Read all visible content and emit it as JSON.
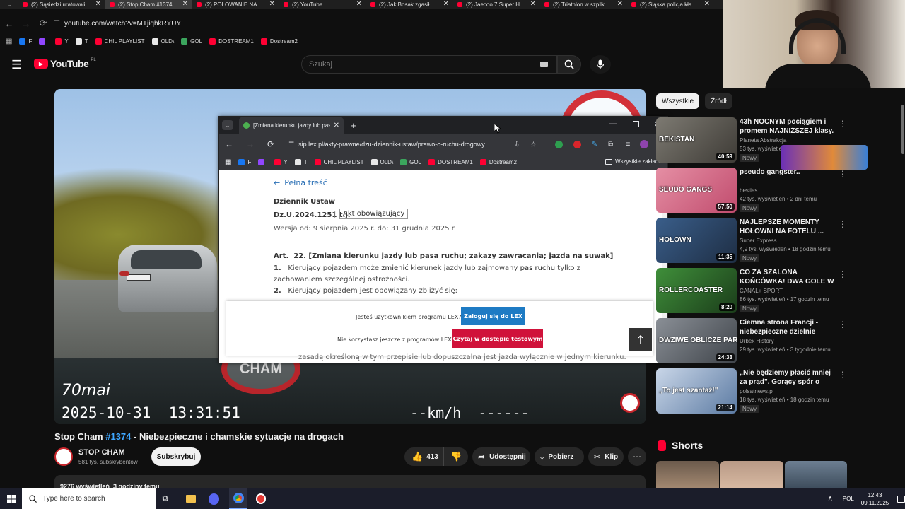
{
  "browser": {
    "tabs": [
      {
        "label": "(2) Sąsiedzi uratowali",
        "active": false
      },
      {
        "label": "(2) Stop Cham #1374",
        "active": true
      },
      {
        "label": "(2) POLOWANIE NA",
        "active": false
      },
      {
        "label": "(2) YouTube",
        "active": false
      },
      {
        "label": "(2) Jak Bosak zgasił",
        "active": false
      },
      {
        "label": "(2) Jaecoo 7 Super H",
        "active": false
      },
      {
        "label": "(2) Triathlon w szpilk",
        "active": false
      },
      {
        "label": "(2) Śląska policja kła",
        "active": false
      }
    ],
    "url": "youtube.com/watch?v=MTjiqhkRYUY",
    "bookmarks": [
      {
        "label": "F",
        "color": "#1877f2"
      },
      {
        "label": "",
        "color": "#9146ff"
      },
      {
        "label": "Y",
        "color": "#ff0033"
      },
      {
        "label": "T",
        "color": "#e8e8e8"
      },
      {
        "label": "CHIL PLAYLIST",
        "color": "#ff0033"
      },
      {
        "label": "OLD\\",
        "color": "#e8e8e8"
      },
      {
        "label": "GOL",
        "color": "#3ba55d"
      },
      {
        "label": "DOSTREAM1",
        "color": "#ff0033"
      },
      {
        "label": "Dostream2",
        "color": "#ff0033"
      }
    ]
  },
  "youtube": {
    "logo": "YouTube",
    "logo_sup": "PL",
    "search_placeholder": "Szukaj"
  },
  "video": {
    "cam_brand": "70mai",
    "timestamp": "2025-10-31  13:31:51",
    "speed": "--km/h  ------",
    "title_prefix": "Stop Cham ",
    "title_tag": "#1374",
    "title_suffix": " - Niebezpieczne i chamskie sytuacje na drogach",
    "channel": "STOP CHAM",
    "subs": "581 tys. subskrybentów",
    "subscribe": "Subskrybuj",
    "likes": "413",
    "share": "Udostępnij",
    "download": "Pobierz",
    "clip": "Klip",
    "views_line": "9276 wyświetleń  3 godziny temu"
  },
  "popup": {
    "tab_title": "[Zmiana kierunku jazdy lub pas",
    "url": "sip.lex.pl/akty-prawne/dzu-dziennik-ustaw/prawo-o-ruchu-drogowy...",
    "bookmarks": [
      "F",
      "",
      "Y",
      "T",
      "CHIL PLAYLIST",
      "OLD\\",
      "GOL",
      "DOSTREAM1",
      "Dostream2"
    ],
    "all_bookmarks": "Wszystkie zakładki",
    "back_link": "Pełna treść",
    "journal": "Dziennik Ustaw",
    "act_ref": "Dz.U.2024.1251 t.j.",
    "act_status": "Akt obowiązujący",
    "version": "Wersja od: 9 sierpnia 2025 r. do: 31 grudnia 2025 r.",
    "art_no": "Art.  22.",
    "art_title": "[Zmiana kierunku jazdy lub pasa ruchu; zakazy zawracania; jazda na suwak]",
    "p1_num": "1.",
    "p1_a": "Kierujący pojazdem może ",
    "p1_b": "zmienić",
    "p1_c": " kierunek jazdy lub zajmowany ",
    "p1_d": "pas ruchu",
    "p1_e": " tylko z",
    "p1_line2": "zachowaniem szczególnej ostrożności.",
    "p2_num": "2.",
    "p2_text": "Kierujący pojazdem jest obowiązany zbliżyć się:",
    "hidden_line": "zasadą określoną w tym przepisie lub dopuszczalna jest jazda wyłącznie w jednym kierunku.",
    "q1": "Jesteś użytkownikiem programu LEX?",
    "btn_login": "Zaloguj się do LEX",
    "q2": "Nie korzystasz jeszcze z programów LEX?",
    "btn_trial": "Czytaj w dostępie testowym"
  },
  "sidebar": {
    "chips": [
      "Wszystkie",
      "Źródł"
    ],
    "recs": [
      {
        "title": "43h NOCNYM pociągiem i promem NAJNIŻSZEJ klasy.",
        "channel": "Planeta Abstrakcja",
        "meta": "53 tys. wyświetleń",
        "badge": "Nowy",
        "duration": "40:59",
        "thumb_text": "BEKISTAN",
        "c1": "#7d7a72",
        "c2": "#3e3b36"
      },
      {
        "title": "pseudo gangster..",
        "channel": "besties",
        "meta": "42 tys. wyświetleń • 2 dni temu",
        "badge": "Nowy",
        "duration": "57:50",
        "thumb_text": "SEUDO GANGS",
        "c1": "#e58fa4",
        "c2": "#c14c6e"
      },
      {
        "title": "NAJLEPSZE MOMENTY HOŁOWNI NA FOTELU ...",
        "channel": "Super Express",
        "meta": "4,9 tys. wyświetleń • 18 godzin temu",
        "badge": "Nowy",
        "duration": "11:35",
        "thumb_text": "HOŁOWN",
        "c1": "#3a5e8a",
        "c2": "#1e2e44"
      },
      {
        "title": "CO ZA SZALONA KOŃCÓWKA! DWA GOLE W DOLICZONYM ...",
        "channel": "CANAL+ SPORT",
        "meta": "86 tys. wyświetleń • 17 godzin temu",
        "badge": "Nowy",
        "duration": "8:20",
        "thumb_text": "ROLLERCOASTER",
        "c1": "#3f8f3a",
        "c2": "#1b3d1a"
      },
      {
        "title": "Ciemna strona Francji - niebezpieczne dzielnie Paryża",
        "channel": "Urbex History",
        "meta": "29 tys. wyświetleń • 3 tygodnie temu",
        "badge": "",
        "duration": "24:33",
        "thumb_text": "DWZIWE OBLICZE PARYŻA",
        "c1": "#8a8f96",
        "c2": "#3f444a"
      },
      {
        "title": "„Nie będziemy płacić mniej za prąd\". Gorący spór o przyszłoś...",
        "channel": "polsatnews.pl",
        "meta": "18 tys. wyświetleń • 18 godzin temu",
        "badge": "Nowy",
        "duration": "21:14",
        "thumb_text": "„To jest szantaż!\"",
        "c1": "#c9d6e8",
        "c2": "#5c7ba3"
      }
    ],
    "shorts_label": "Shorts"
  },
  "taskbar": {
    "search_placeholder": "Type here to search",
    "lang": "POL",
    "time": "12:43",
    "date": "09.11.2025"
  }
}
